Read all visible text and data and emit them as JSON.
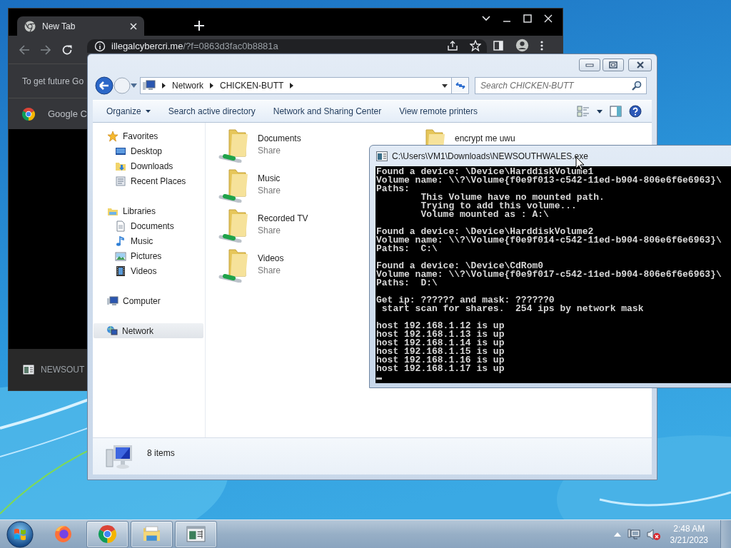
{
  "browser": {
    "tabs": [
      {
        "title": "New Tab",
        "selected": true
      }
    ],
    "url": {
      "host": "illegalcybercri.me",
      "path": "/?f=0863d3fac0b8881a"
    },
    "infobar": {
      "text": "To get future Go"
    },
    "bookmarks": [
      {
        "label": "Google C"
      }
    ],
    "download_bar": {
      "file": "NEWSOUT"
    }
  },
  "explorer": {
    "breadcrumb": [
      "Network",
      "CHICKEN-BUTT"
    ],
    "search": {
      "placeholder": "Search CHICKEN-BUTT"
    },
    "commands": [
      {
        "label": "Organize",
        "menu": true
      },
      {
        "label": "Search active directory",
        "menu": false
      },
      {
        "label": "Network and Sharing Center",
        "menu": false
      },
      {
        "label": "View remote printers",
        "menu": false
      }
    ],
    "nav": [
      {
        "label": "Favorites",
        "kind": "favorites",
        "selected": false,
        "children": [
          {
            "label": "Desktop",
            "kind": "desktop",
            "selected": false
          },
          {
            "label": "Downloads",
            "kind": "downloads",
            "selected": false
          },
          {
            "label": "Recent Places",
            "kind": "recent",
            "selected": false
          }
        ]
      },
      {
        "label": "Libraries",
        "kind": "libraries",
        "selected": false,
        "children": [
          {
            "label": "Documents",
            "kind": "document",
            "selected": false
          },
          {
            "label": "Music",
            "kind": "music",
            "selected": false
          },
          {
            "label": "Pictures",
            "kind": "pictures",
            "selected": false
          },
          {
            "label": "Videos",
            "kind": "videos",
            "selected": false
          }
        ]
      },
      {
        "label": "Computer",
        "kind": "computer",
        "selected": false
      },
      {
        "label": "Network",
        "kind": "network",
        "selected": true
      }
    ],
    "items": [
      {
        "name": "Documents",
        "detail": "Share",
        "kind": "share"
      },
      {
        "name": "Music",
        "detail": "Share",
        "kind": "share"
      },
      {
        "name": "Recorded TV",
        "detail": "Share",
        "kind": "share"
      },
      {
        "name": "Videos",
        "detail": "Share",
        "kind": "share"
      },
      {
        "name": "encrypt me uwu",
        "kind": "folder"
      }
    ],
    "status": {
      "text": "8 items"
    }
  },
  "console": {
    "title": "C:\\Users\\VM1\\Downloads\\NEWSOUTHWALES.exe",
    "blocks": [
      [
        "Found a device: \\Device\\HarddiskVolume1",
        "Volume name: \\\\?\\Volume{f0e9f013-c542-11ed-b904-806e6f6e6963}\\",
        "Paths:",
        "        This Volume have no mounted path.",
        "        Trying to add this volume...",
        "        Volume mounted as : A:\\"
      ],
      [
        "Found a device: \\Device\\HarddiskVolume2",
        "Volume name: \\\\?\\Volume{f0e9f014-c542-11ed-b904-806e6f6e6963}\\",
        "Paths:  C:\\"
      ],
      [
        "Found a device: \\Device\\CdRom0",
        "Volume name: \\\\?\\Volume{f0e9f017-c542-11ed-b904-806e6f6e6963}\\",
        "Paths:  D:\\"
      ],
      [
        "Get ip: ?????? and mask: ??????0",
        " start scan for shares.  254 ips by network mask"
      ],
      [
        "host 192.168.1.12 is up",
        "host 192.168.1.13 is up",
        "host 192.168.1.14 is up",
        "host 192.168.1.15 is up",
        "host 192.168.1.16 is up",
        "host 192.168.1.17 is up"
      ]
    ]
  },
  "taskbar": {
    "apps": [
      {
        "kind": "firefox",
        "running": false
      },
      {
        "kind": "chrome",
        "running": true
      },
      {
        "kind": "explorer",
        "running": true
      },
      {
        "kind": "console",
        "running": true
      }
    ],
    "clock": {
      "time": "2:48 AM",
      "date": "3/21/2023"
    }
  }
}
